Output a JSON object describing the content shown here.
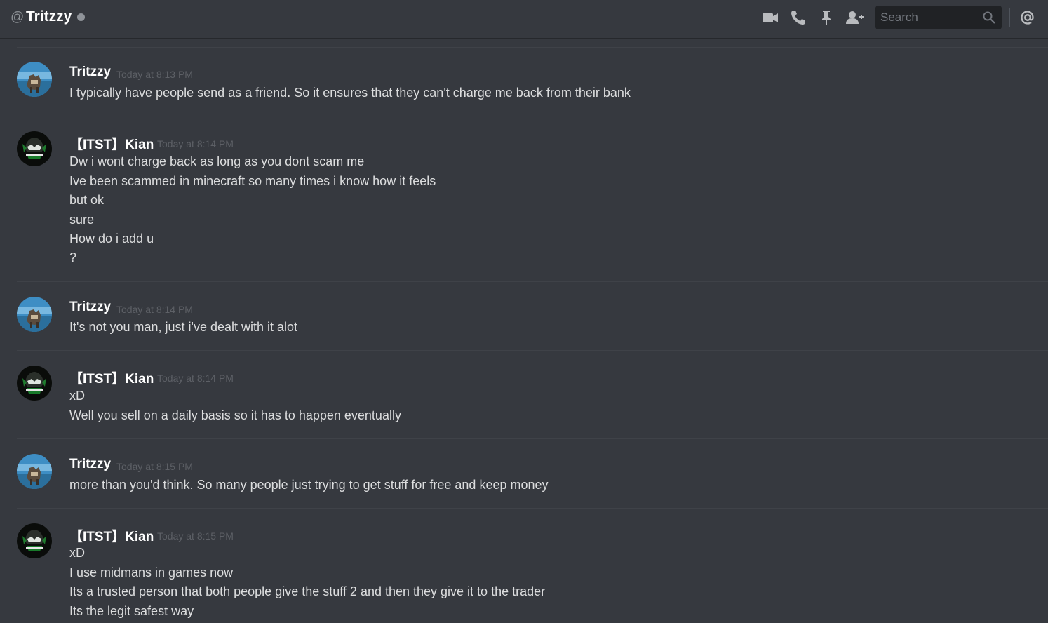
{
  "header": {
    "at_symbol": "@",
    "title": "Tritzzy",
    "status": "offline",
    "search_placeholder": "Search",
    "icons": [
      "video-call-icon",
      "voice-call-icon",
      "pin-icon",
      "add-friend-icon",
      "search-icon",
      "mentions-icon"
    ]
  },
  "colors": {
    "background": "#36393f",
    "username": "#ffffff",
    "message_text": "#dcddde",
    "timestamp": "#5d6066",
    "status_offline": "#8f9399",
    "search_bg": "#202225"
  },
  "messages": [
    {
      "author": "Tritzzy",
      "timestamp": "Today at 8:13 PM",
      "avatar": "tritzzy-avatar",
      "lines": [
        "I typically have people send as a friend. So it ensures that they can't charge me back from their bank"
      ]
    },
    {
      "author": "【ITST】Kian",
      "timestamp": "Today at 8:14 PM",
      "avatar": "kian-avatar",
      "lines": [
        "Dw i wont charge back as long as you dont scam me",
        "Ive been scammed in minecraft so many times i know how it feels",
        "but ok",
        "sure",
        "How do i add u",
        "?"
      ]
    },
    {
      "author": "Tritzzy",
      "timestamp": "Today at 8:14 PM",
      "avatar": "tritzzy-avatar",
      "lines": [
        "It's not you man, just i've dealt with it alot"
      ]
    },
    {
      "author": "【ITST】Kian",
      "timestamp": "Today at 8:14 PM",
      "avatar": "kian-avatar",
      "lines": [
        "xD",
        "Well you sell on a daily basis so it has to happen eventually"
      ]
    },
    {
      "author": "Tritzzy",
      "timestamp": "Today at 8:15 PM",
      "avatar": "tritzzy-avatar",
      "lines": [
        "more than you'd think. So many people just trying to get stuff for free and keep money"
      ]
    },
    {
      "author": "【ITST】Kian",
      "timestamp": "Today at 8:15 PM",
      "avatar": "kian-avatar",
      "lines": [
        "xD",
        "I use midmans in games now",
        "Its a trusted person that both people give the stuff 2 and then they give it to the trader",
        "Its the legit safest way"
      ]
    }
  ]
}
